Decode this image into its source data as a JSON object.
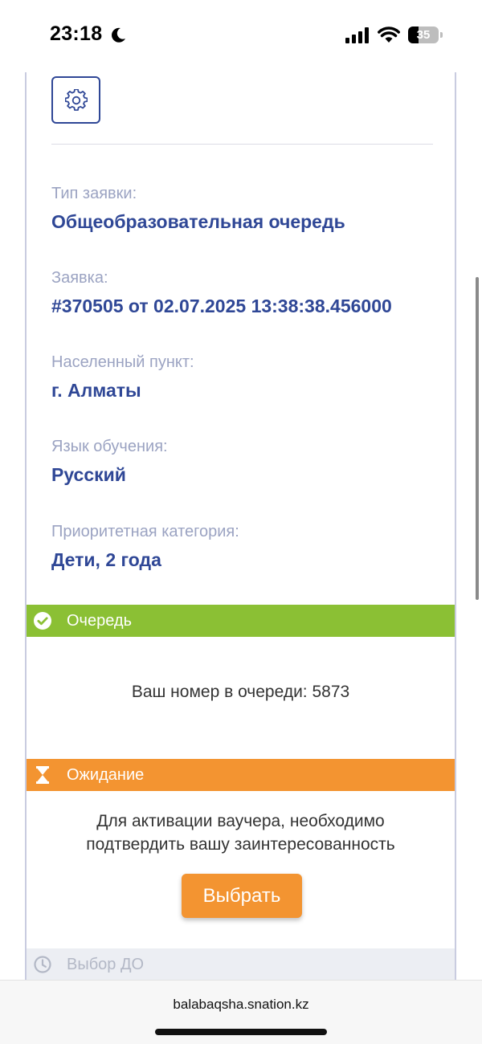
{
  "status_bar": {
    "time": "23:18",
    "battery_percent": "35",
    "battery_level": 0.35
  },
  "application": {
    "fields": [
      {
        "label": "Тип заявки:",
        "value": "Общеобразовательная очередь"
      },
      {
        "label": "Заявка:",
        "value": "#370505 от 02.07.2025 13:38:38.456000"
      },
      {
        "label": "Населенный пункт:",
        "value": "г. Алматы"
      },
      {
        "label": "Язык обучения:",
        "value": "Русский"
      },
      {
        "label": "Приоритетная категория:",
        "value": "Дети, 2 года"
      }
    ]
  },
  "steps": {
    "queue": {
      "title": "Очередь",
      "text": "Ваш номер в очереди: 5873",
      "color": "#8bc034"
    },
    "waiting": {
      "title": "Ожидание",
      "text_line1": "Для активации ваучера, необходимо",
      "text_line2": "подтвердить вашу заинтересованность",
      "button_label": "Выбрать",
      "color": "#f39431"
    },
    "choice": {
      "title": "Выбор ДО",
      "color": "#eceef3"
    }
  },
  "browser": {
    "url": "balabaqsha.snation.kz"
  },
  "icons": {
    "settings": "gear-icon",
    "queue": "check-circle-icon",
    "waiting": "hourglass-icon",
    "choice": "clock-icon"
  },
  "colors": {
    "accent_blue": "#2f4796",
    "label_gray": "#9ba3c2"
  }
}
